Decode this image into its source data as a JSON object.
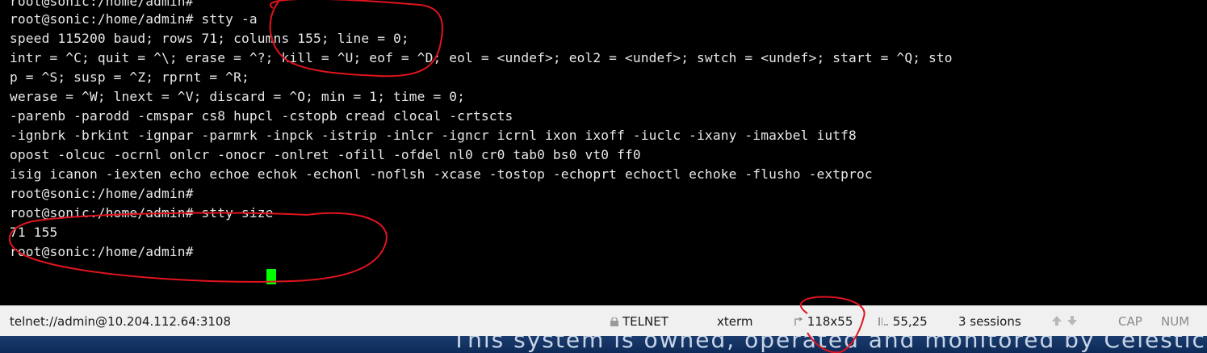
{
  "terminal": {
    "lines": [
      "root@sonic:/home/admin#",
      "root@sonic:/home/admin# stty -a",
      "speed 115200 baud; rows 71; columns 155; line = 0;",
      "intr = ^C; quit = ^\\; erase = ^?; kill = ^U; eof = ^D; eol = <undef>; eol2 = <undef>; swtch = <undef>; start = ^Q; sto",
      "p = ^S; susp = ^Z; rprnt = ^R;",
      "werase = ^W; lnext = ^V; discard = ^O; min = 1; time = 0;",
      "-parenb -parodd -cmspar cs8 hupcl -cstopb cread clocal -crtscts",
      "-ignbrk -brkint -ignpar -parmrk -inpck -istrip -inlcr -igncr icrnl ixon ixoff -iuclc -ixany -imaxbel iutf8",
      "opost -olcuc -ocrnl onlcr -onocr -onlret -ofill -ofdel nl0 cr0 tab0 bs0 vt0 ff0",
      "isig icanon -iexten echo echoe echok -echonl -noflsh -xcase -tostop -echoprt echoctl echoke -flusho -extproc",
      "root@sonic:/home/admin#",
      "root@sonic:/home/admin# stty size",
      "71 155",
      "root@sonic:/home/admin# "
    ]
  },
  "status_bar": {
    "connection": "telnet://admin@10.204.112.64:3108",
    "protocol": "TELNET",
    "terminal_type": "xterm",
    "window_size": "118x55",
    "cursor_position": "55,25",
    "sessions": "3 sessions",
    "cap": "CAP",
    "num": "NUM"
  },
  "background_text": "This system is owned, operated and monitored by Celestica Inc. and",
  "colors": {
    "terminal_bg": "#000000",
    "terminal_fg": "#e8e8e8",
    "cursor": "#00ff00",
    "annotation": "#e0141e",
    "status_bg": "#f0f0f0"
  },
  "icons": [
    "lock-icon",
    "resize-icon",
    "cursor-position-icon",
    "arrow-up-icon",
    "arrow-down-icon"
  ]
}
